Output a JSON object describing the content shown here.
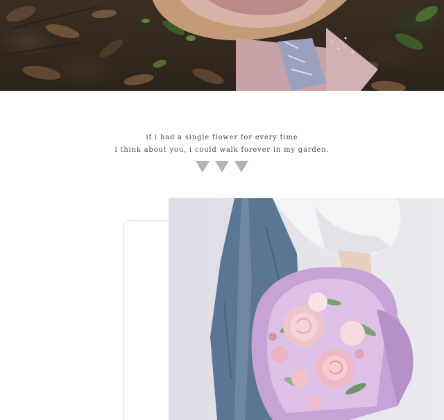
{
  "quote": {
    "line1": "if i had a single flower for every time",
    "line2": "i think about you, i could walk forever in my garden."
  },
  "colors": {
    "arrow": "#b3b3b3",
    "bouquet_wrap": "#c7a2d6",
    "rose": "#f0c4cc"
  }
}
